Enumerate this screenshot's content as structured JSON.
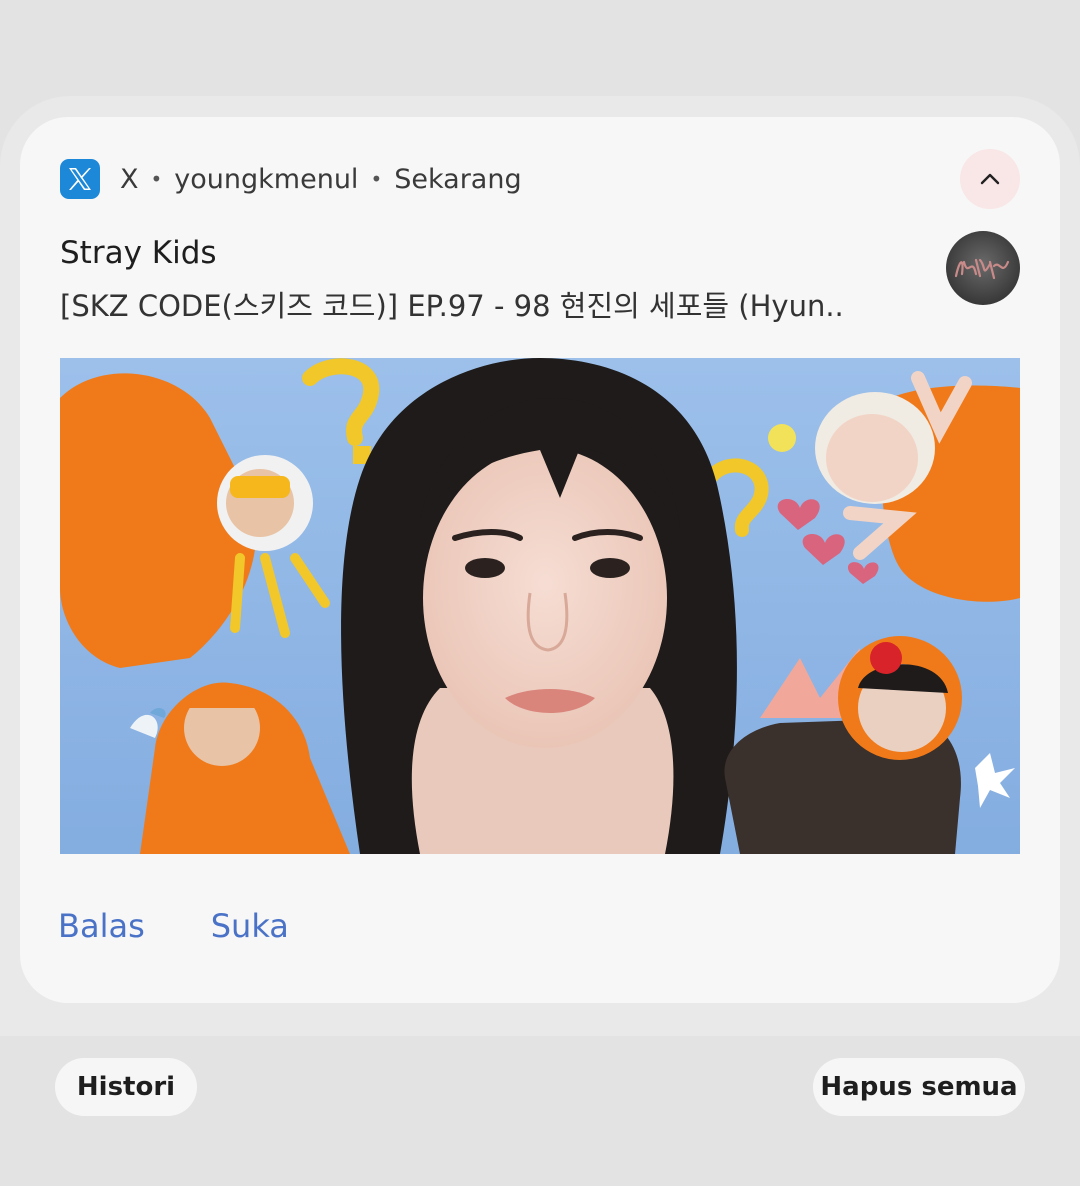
{
  "notification": {
    "app_name": "X",
    "app_icon": "x-logo-icon",
    "account": "youngkmenul",
    "time": "Sekarang",
    "separator": "•",
    "title": "Stray Kids",
    "body": "[SKZ CODE(스키즈 코드)] EP.97 - 98 현진의 세포들 (Hyun..",
    "avatar_text": "Stray Kids",
    "actions": {
      "reply": "Balas",
      "like": "Suka"
    },
    "accent_color": "#4a73c8",
    "icon_color": "#1d87d8"
  },
  "footer": {
    "history_label": "Histori",
    "clear_all_label": "Hapus semua"
  }
}
